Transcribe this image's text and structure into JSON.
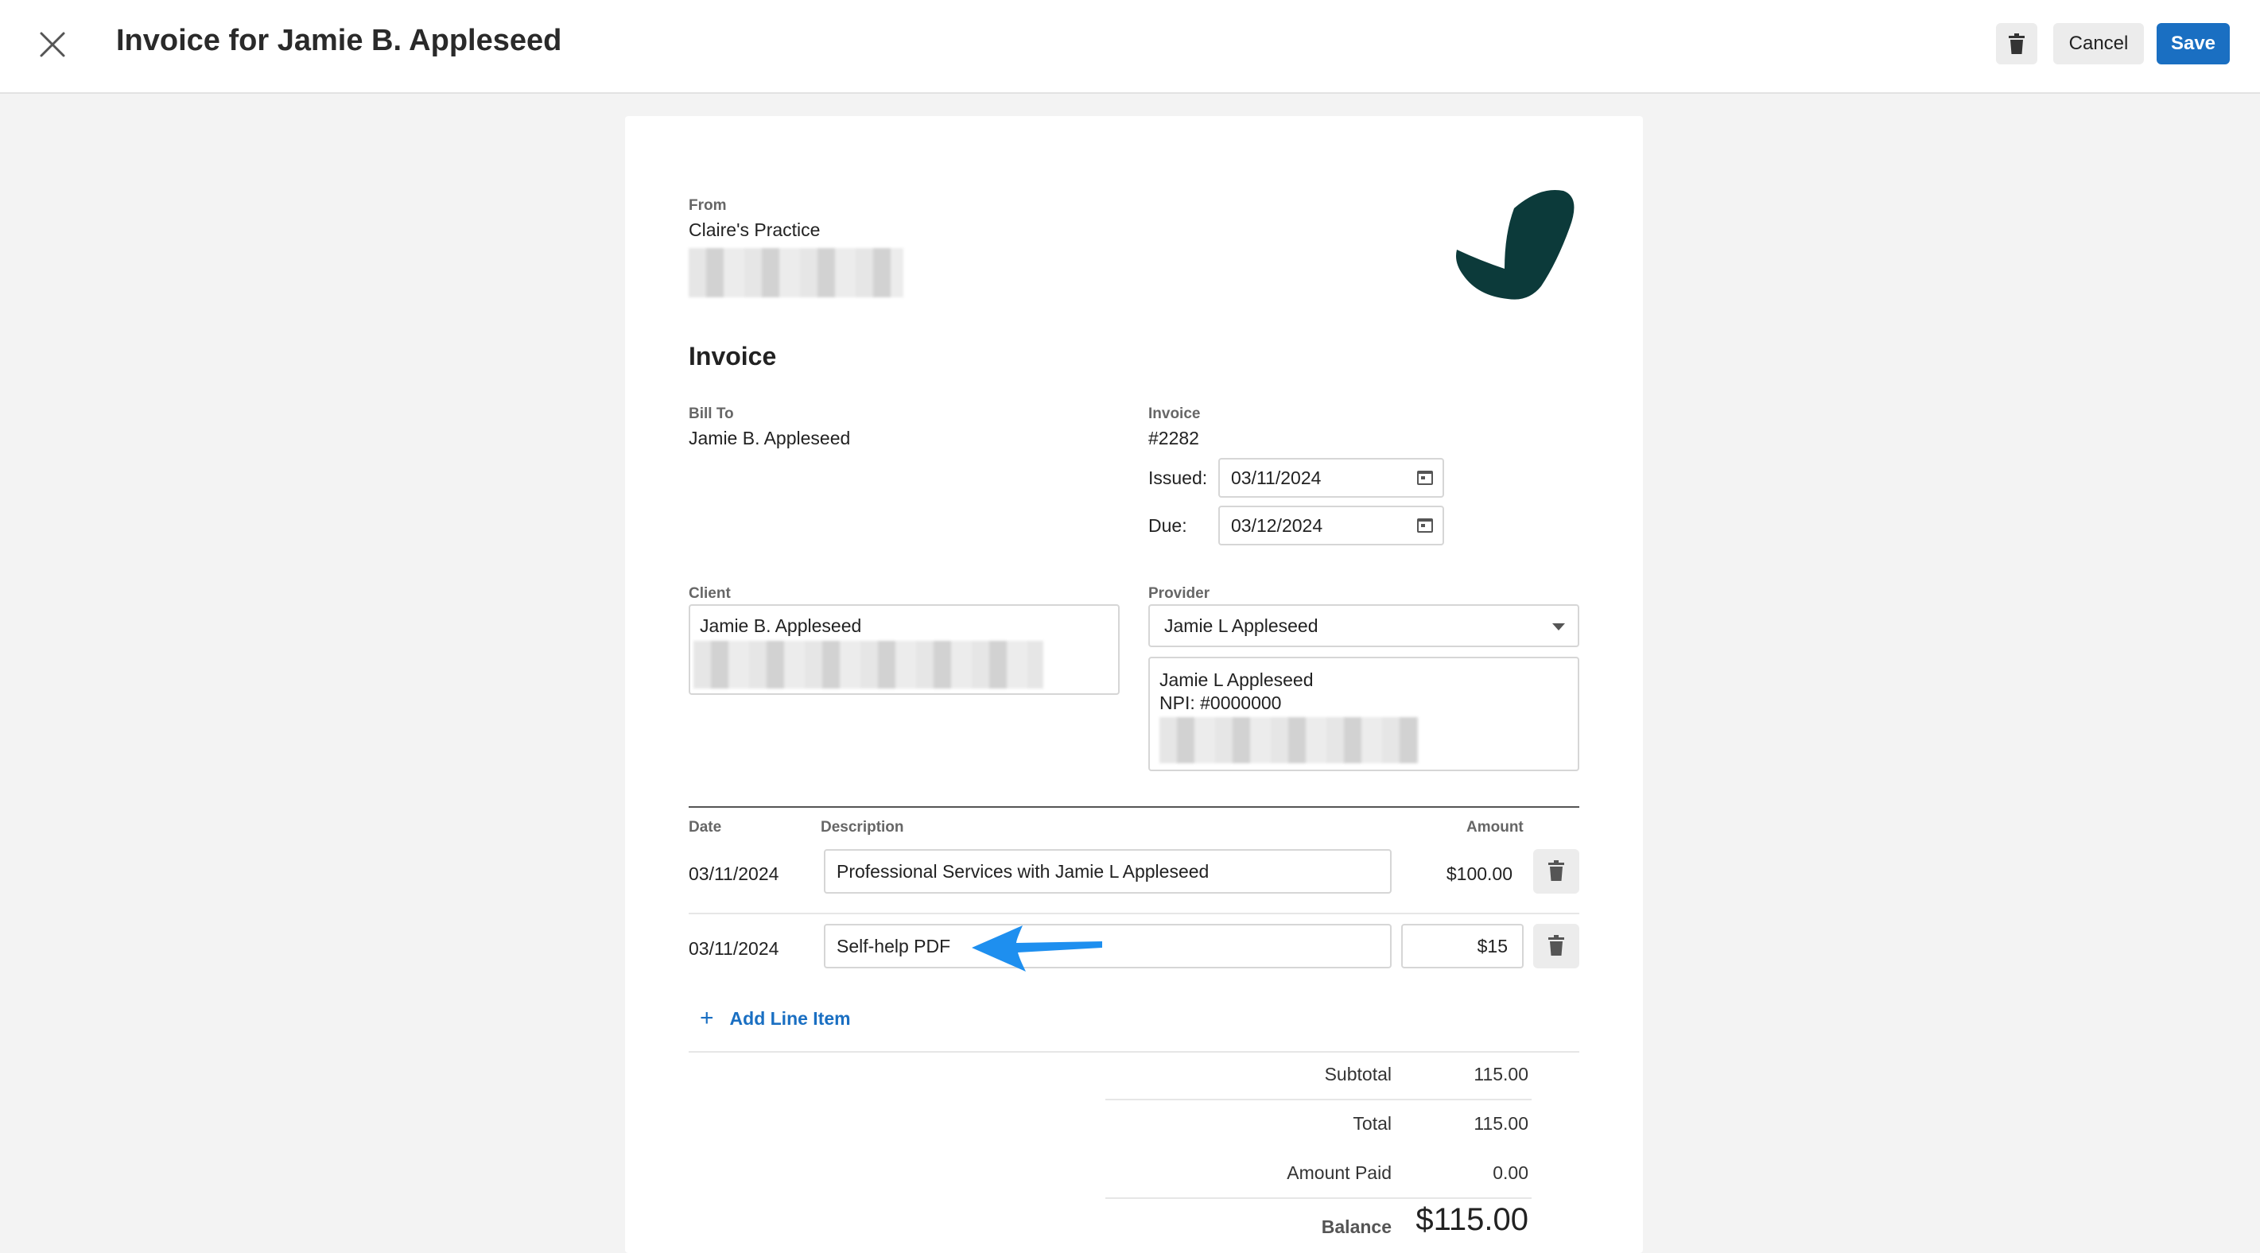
{
  "header": {
    "title": "Invoice for Jamie B. Appleseed",
    "cancel_label": "Cancel",
    "save_label": "Save"
  },
  "from": {
    "label": "From",
    "practice_name": "Claire's Practice"
  },
  "invoice": {
    "heading": "Invoice",
    "bill_to_label": "Bill To",
    "bill_to_name": "Jamie B. Appleseed",
    "invoice_label": "Invoice",
    "number": "#2282",
    "issued_label": "Issued:",
    "issued_date": "03/11/2024",
    "due_label": "Due:",
    "due_date": "03/12/2024"
  },
  "client": {
    "label": "Client",
    "name": "Jamie B. Appleseed"
  },
  "provider": {
    "label": "Provider",
    "selected": "Jamie L Appleseed",
    "name": "Jamie L Appleseed",
    "npi": "NPI: #0000000"
  },
  "line_items": {
    "headers": {
      "date": "Date",
      "description": "Description",
      "amount": "Amount"
    },
    "rows": [
      {
        "date": "03/11/2024",
        "description": "Professional Services with Jamie L Appleseed",
        "amount": "$100.00"
      },
      {
        "date": "03/11/2024",
        "description": "Self-help PDF",
        "amount": "$15"
      }
    ],
    "add_label": "Add Line Item"
  },
  "summary": {
    "subtotal_label": "Subtotal",
    "subtotal": "115.00",
    "total_label": "Total",
    "total": "115.00",
    "amount_paid_label": "Amount Paid",
    "amount_paid": "0.00",
    "balance_label": "Balance",
    "balance": "$115.00"
  },
  "colors": {
    "accent": "#1a6fc2",
    "logo": "#0c3a3a",
    "annotation_arrow": "#1e8fef"
  },
  "icons": [
    "close-icon",
    "trash-icon",
    "calendar-icon",
    "chevron-down-icon",
    "plus-icon",
    "practice-logo",
    "annotation-arrow"
  ]
}
